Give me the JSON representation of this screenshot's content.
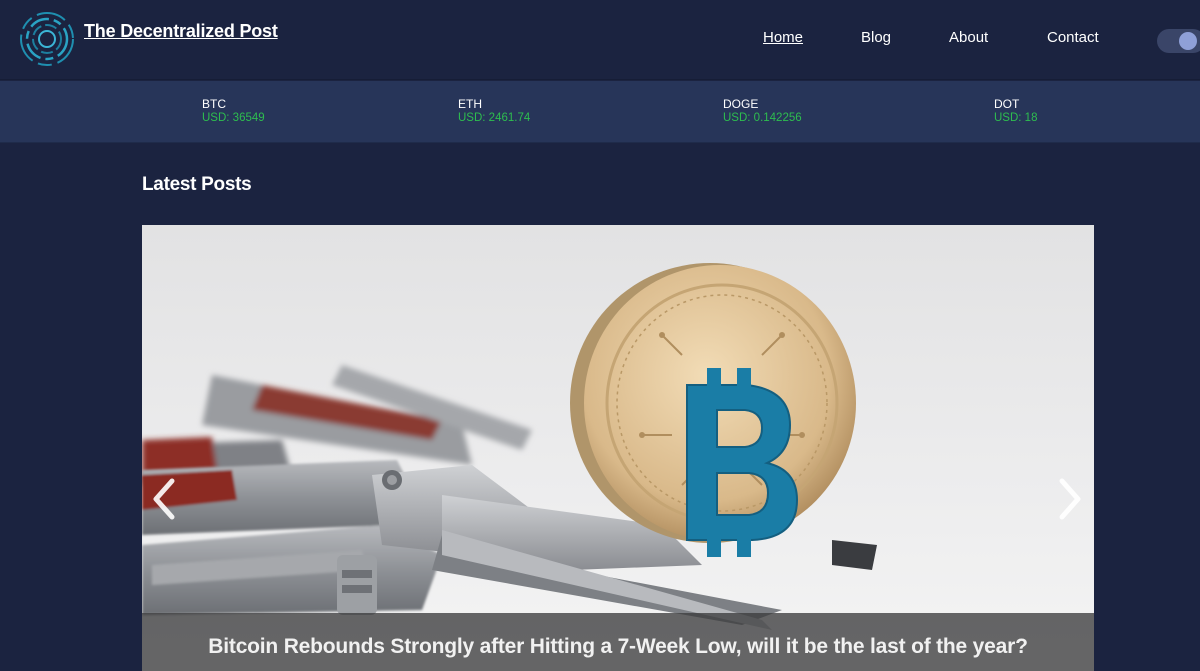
{
  "header": {
    "site_title": "The Decentralized Post",
    "nav": [
      {
        "label": "Home",
        "active": true
      },
      {
        "label": "Blog",
        "active": false
      },
      {
        "label": "About",
        "active": false
      },
      {
        "label": "Contact",
        "active": false
      }
    ],
    "theme_toggle": {
      "state": "on"
    }
  },
  "ticker": [
    {
      "symbol": "BTC",
      "price": "USD: 36549"
    },
    {
      "symbol": "ETH",
      "price": "USD: 2461.74"
    },
    {
      "symbol": "DOGE",
      "price": "USD: 0.142256"
    },
    {
      "symbol": "DOT",
      "price": "USD: 18"
    }
  ],
  "main": {
    "section_title": "Latest Posts",
    "carousel": {
      "slide_caption": "Bitcoin Rebounds Strongly after Hitting a 7-Week Low, will it be the last of the year?",
      "prev_icon": "chevron-left-icon",
      "next_icon": "chevron-right-icon",
      "coin_ring_text": "DECENTRALIZED PEER TO PEER"
    }
  },
  "colors": {
    "background": "#1b2340",
    "ticker_background": "#273559",
    "price_green": "#2ebd4f",
    "coin_blue": "#1a7da6"
  }
}
